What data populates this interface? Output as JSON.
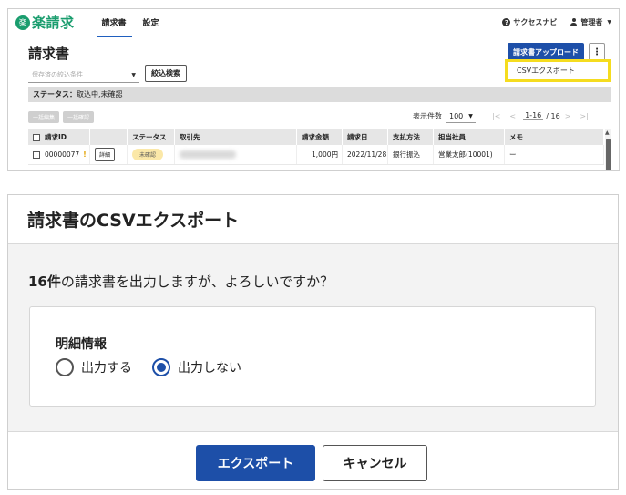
{
  "app": {
    "logo_badge": "楽",
    "logo_text": "楽請求",
    "nav": [
      "請求書",
      "設定"
    ],
    "help_label": "サクセスナビ",
    "user_label": "管理者",
    "page_title": "請求書",
    "upload_label": "請求書アップロード",
    "more_label": "⋮",
    "csv_menu_item": "CSVエクスポート",
    "saved_filter_placeholder": "保存済の絞込条件",
    "narrow_search_label": "絞込検索",
    "status_label": "ステータス：",
    "status_value": "取込中,未確認",
    "bulk_buttons": [
      "一括編集",
      "一括確認"
    ],
    "count_label": "表示件数",
    "count_value": "100",
    "pager": {
      "first": "|<",
      "prev": "<",
      "range": "1-16",
      "total": "/ 16",
      "next": ">",
      "last": ">|"
    },
    "columns": [
      "請求ID",
      "",
      "ステータス",
      "取引先",
      "請求金額",
      "請求日",
      "支払方法",
      "担当社員",
      "メモ"
    ],
    "row": {
      "id": "00000077",
      "warn": "!",
      "detail": "詳細",
      "status": "未確認",
      "amount": "1,000円",
      "date": "2022/11/28",
      "payment": "銀行振込",
      "staff": "営業太郎(10001)",
      "memo": "ー"
    }
  },
  "dialog": {
    "title": "請求書のCSVエクスポート",
    "message_count": "16件",
    "message_rest": "の請求書を出力しますが、よろしいですか？",
    "detail_title": "明細情報",
    "options": [
      "出力する",
      "出力しない"
    ],
    "selected_index": 1,
    "export_label": "エクスポート",
    "cancel_label": "キャンセル"
  }
}
